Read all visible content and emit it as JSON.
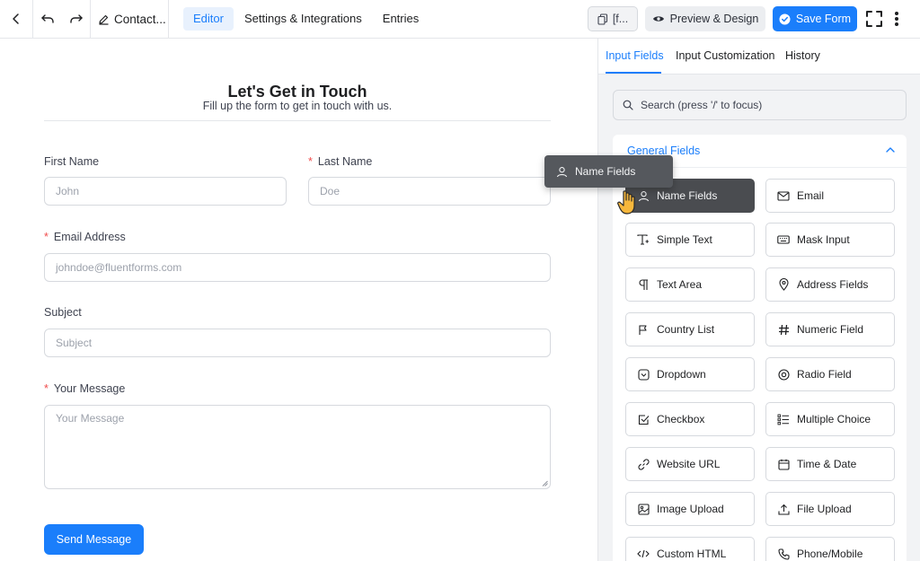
{
  "topbar": {
    "form_title": "Contact...",
    "tabs": [
      {
        "label": "Editor",
        "active": true
      },
      {
        "label": "Settings & Integrations",
        "active": false
      },
      {
        "label": "Entries",
        "active": false
      }
    ],
    "shortcode_label": "[f...",
    "preview_label": "Preview & Design",
    "save_label": "Save Form"
  },
  "form": {
    "title": "Let's Get in Touch",
    "subtitle": "Fill up the form to get in touch with us.",
    "fields": {
      "first_name": {
        "label": "First Name",
        "placeholder": "John",
        "required": false
      },
      "last_name": {
        "label": "Last Name",
        "placeholder": "Doe",
        "required": true
      },
      "email": {
        "label": "Email Address",
        "placeholder": "johndoe@fluentforms.com",
        "required": true
      },
      "subject": {
        "label": "Subject",
        "placeholder": "Subject",
        "required": false
      },
      "message": {
        "label": "Your Message",
        "placeholder": "Your Message",
        "required": true
      }
    },
    "required_mark": "*",
    "submit_label": "Send Message"
  },
  "sidebar": {
    "tabs": [
      {
        "label": "Input Fields",
        "active": true
      },
      {
        "label": "Input Customization",
        "active": false
      },
      {
        "label": "History",
        "active": false
      }
    ],
    "search_placeholder": "Search (press '/' to focus)",
    "section_title": "General Fields",
    "fields": [
      {
        "label": "Name Fields",
        "icon": "user-icon"
      },
      {
        "label": "Email",
        "icon": "envelope-icon"
      },
      {
        "label": "Simple Text",
        "icon": "text-cursor-icon"
      },
      {
        "label": "Mask Input",
        "icon": "keyboard-icon"
      },
      {
        "label": "Text Area",
        "icon": "paragraph-icon"
      },
      {
        "label": "Address Fields",
        "icon": "map-pin-icon"
      },
      {
        "label": "Country List",
        "icon": "flag-icon"
      },
      {
        "label": "Numeric Field",
        "icon": "hash-icon"
      },
      {
        "label": "Dropdown",
        "icon": "dropdown-icon"
      },
      {
        "label": "Radio Field",
        "icon": "radio-icon"
      },
      {
        "label": "Checkbox",
        "icon": "checkbox-icon"
      },
      {
        "label": "Multiple Choice",
        "icon": "list-icon"
      },
      {
        "label": "Website URL",
        "icon": "link-icon"
      },
      {
        "label": "Time & Date",
        "icon": "calendar-icon"
      },
      {
        "label": "Image Upload",
        "icon": "image-icon"
      },
      {
        "label": "File Upload",
        "icon": "upload-icon"
      },
      {
        "label": "Custom HTML",
        "icon": "code-icon"
      },
      {
        "label": "Phone/Mobile",
        "icon": "phone-icon"
      }
    ],
    "drag_ghost_label": "Name Fields"
  },
  "colors": {
    "accent": "#1a7efb",
    "required": "#f04c4c",
    "dragging_bg": "#4a4c50",
    "sidebar_bg": "#f2f3f5"
  }
}
